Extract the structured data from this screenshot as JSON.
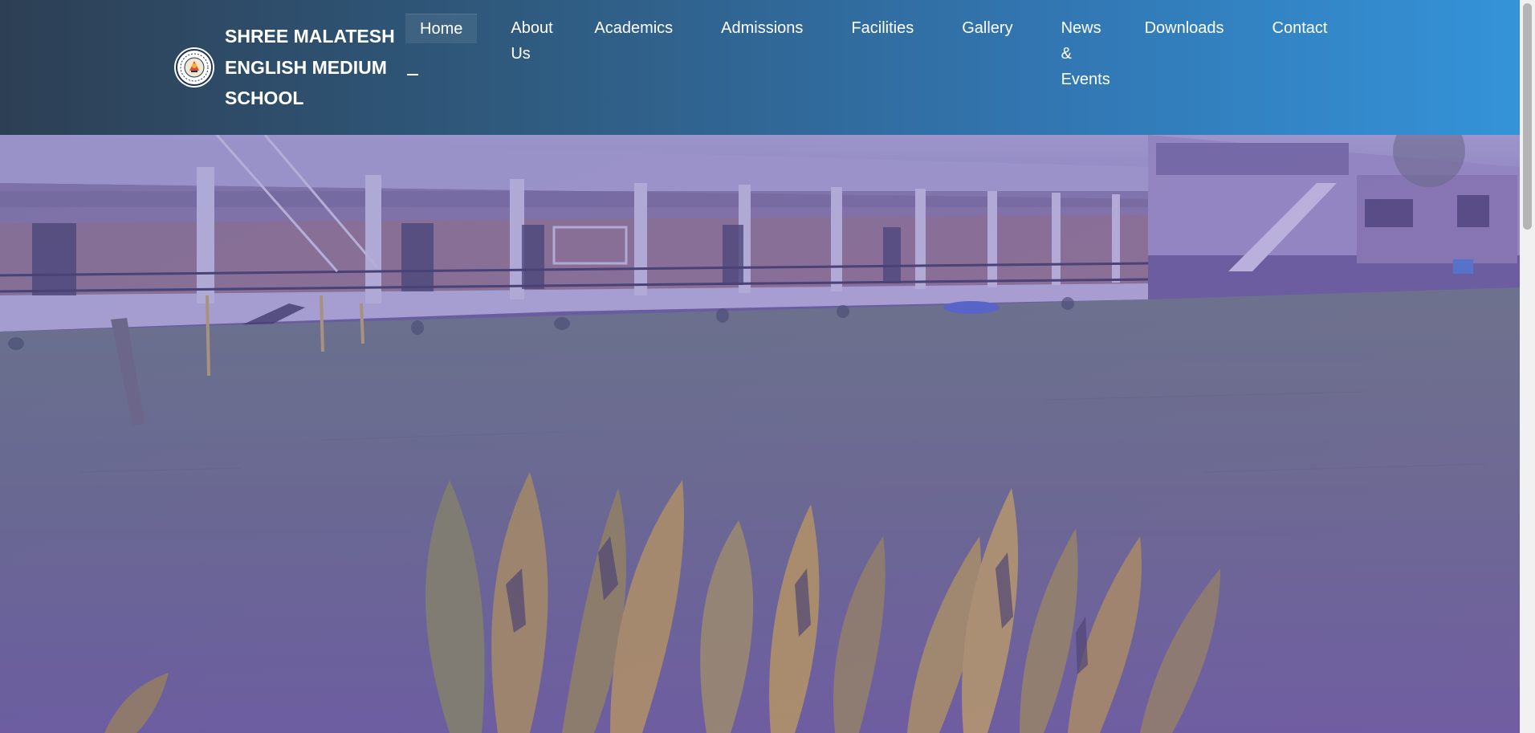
{
  "brand": {
    "name_line1": "SHREE MALATESH",
    "name_line2": "ENGLISH MEDIUM",
    "name_line3": "SCHOOL",
    "logo_icon": "school-crest-icon"
  },
  "nav": {
    "items": [
      {
        "label": "Home",
        "active": true
      },
      {
        "label": "About Us"
      },
      {
        "label": "Academics"
      },
      {
        "label": "Admissions"
      },
      {
        "label": "Facilities"
      },
      {
        "label": "Gallery"
      },
      {
        "label": "News & Events"
      },
      {
        "label": "Downloads"
      },
      {
        "label": "Contact"
      }
    ]
  },
  "hero": {
    "image": "school-building-and-lawn-photo",
    "overlay_color": "#6a5fb0"
  },
  "colors": {
    "header_start": "#2d3f54",
    "header_end": "#3493d8",
    "text": "#ffffff"
  }
}
